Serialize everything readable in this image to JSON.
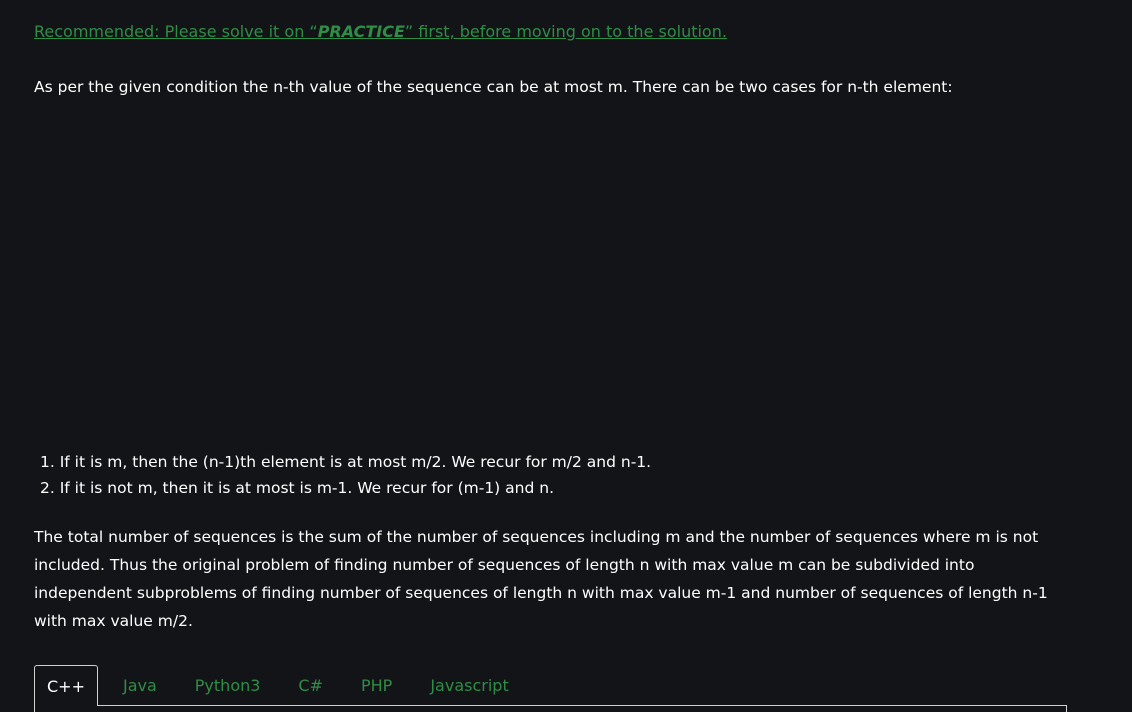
{
  "recommended": {
    "prefix": "Recommended: Please solve it on “",
    "practice": "PRACTICE",
    "suffix": "” first, before moving on to the solution."
  },
  "intro": "As per the given condition the n-th value of the sequence can be at most m. There can be two cases for n-th element:",
  "cases": [
    "1. If it is m, then the (n-1)th element is at most m/2. We recur for m/2 and n-1.",
    "2. If it is not m, then it is at most is m-1. We recur for (m-1) and n."
  ],
  "summary": "The total number of sequences is the sum of the number of sequences including m and the number of sequences where m is not included. Thus the original problem of finding number of sequences of length n with max value m can be subdivided into independent subproblems of finding number of sequences of length n with max value m-1 and number of sequences of length n-1 with max value m/2.",
  "tabs": [
    {
      "label": "C++"
    },
    {
      "label": "Java"
    },
    {
      "label": "Python3"
    },
    {
      "label": "C#"
    },
    {
      "label": "PHP"
    },
    {
      "label": "Javascript"
    }
  ],
  "colors": {
    "background": "#131417",
    "link_green": "#2f8d46",
    "text": "#ffffff"
  }
}
